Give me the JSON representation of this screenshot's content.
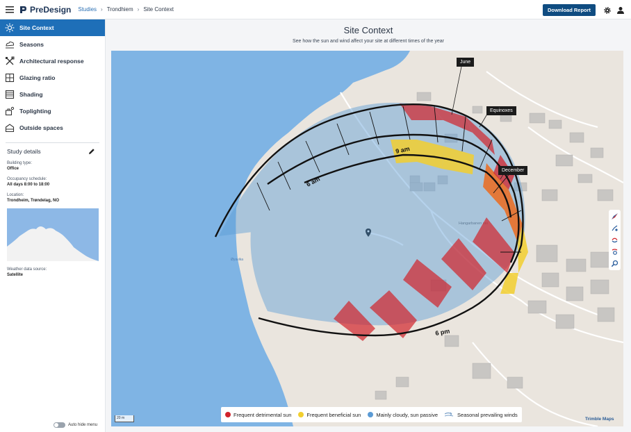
{
  "header": {
    "app_name": "PreDesign",
    "breadcrumbs": [
      "Studies",
      "Trondhiem",
      "Site Context"
    ],
    "download_label": "Download Report"
  },
  "sidebar": {
    "items": [
      {
        "label": "Site Context",
        "icon": "sun-icon",
        "active": true
      },
      {
        "label": "Seasons",
        "icon": "seasons-icon",
        "active": false
      },
      {
        "label": "Architectural response",
        "icon": "tools-icon",
        "active": false
      },
      {
        "label": "Glazing ratio",
        "icon": "window-icon",
        "active": false
      },
      {
        "label": "Shading",
        "icon": "shading-icon",
        "active": false
      },
      {
        "label": "Toplighting",
        "icon": "toplighting-icon",
        "active": false
      },
      {
        "label": "Outside spaces",
        "icon": "outside-spaces-icon",
        "active": false
      }
    ],
    "study_details": {
      "heading": "Study details",
      "building_type_label": "Building type:",
      "building_type": "Office",
      "occupancy_label": "Occupancy schedule:",
      "occupancy": "All days 8:00 to 18:00",
      "location_label": "Location:",
      "location": "Trondheim, Trøndelag, NO",
      "weather_label": "Weather data source:",
      "weather": "Satellite"
    },
    "auto_hide_label": "Auto hide menu"
  },
  "main": {
    "title": "Site Context",
    "subtitle": "See how the sun and wind affect your site at different times of the year"
  },
  "map": {
    "tooltips": {
      "june": "June",
      "equinoxes": "Equinoxes",
      "december": "December"
    },
    "hour_labels": {
      "nine": "9 am",
      "six": "6 am",
      "six_pm": "6 pm"
    },
    "street_label": "Hangarbanen vei",
    "scale_label": "20 m",
    "attribution": "Trimble Maps",
    "water_label": "Øyavika"
  },
  "legend": {
    "items": [
      {
        "label": "Frequent detrimental sun",
        "color": "#d1232b"
      },
      {
        "label": "Frequent beneficial sun",
        "color": "#f2cf2f"
      },
      {
        "label": "Mainly cloudy, sun passive",
        "color": "#5b9bd5"
      },
      {
        "label": "Seasonal prevailing winds",
        "color": "#7aa0c8"
      }
    ]
  },
  "colors": {
    "accent": "#1e6fb8",
    "button": "#0f4c81",
    "water": "#7fb4e4",
    "land": "#eae5de"
  }
}
